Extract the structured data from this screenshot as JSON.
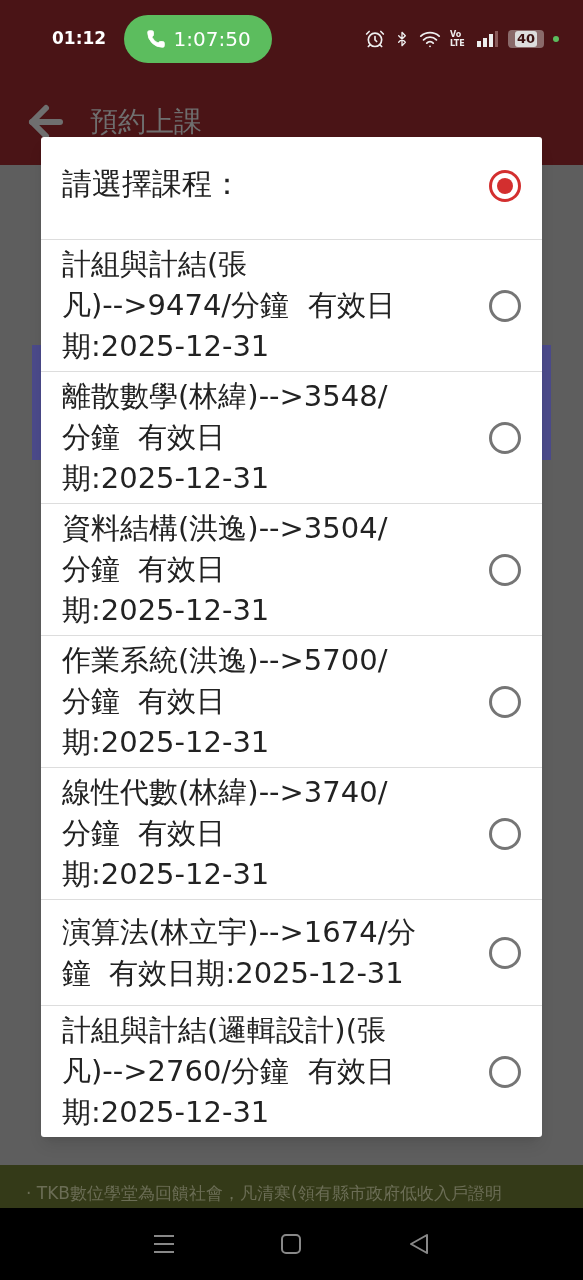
{
  "status_bar": {
    "time": "01:12",
    "call_timer": "1:07:50",
    "network": "Vo LTE",
    "battery": "40"
  },
  "header": {
    "title": "預約上課"
  },
  "footer_note": "· TKB數位學堂為回饋社會，凡清寒(領有縣市政府低收入戶證明",
  "dialog": {
    "prompt": {
      "text": "請選擇課程：",
      "selected": true
    },
    "options": [
      {
        "lines": [
          "計組與計結(張",
          "凡)-->9474/分鐘  有效日",
          "期:2025-12-31"
        ],
        "selected": false
      },
      {
        "lines": [
          "離散數學(林緯)-->3548/",
          "分鐘  有效日",
          "期:2025-12-31"
        ],
        "selected": false
      },
      {
        "lines": [
          "資料結構(洪逸)-->3504/",
          "分鐘  有效日",
          "期:2025-12-31"
        ],
        "selected": false
      },
      {
        "lines": [
          "作業系統(洪逸)-->5700/",
          "分鐘  有效日",
          "期:2025-12-31"
        ],
        "selected": false
      },
      {
        "lines": [
          "線性代數(林緯)-->3740/",
          "分鐘  有效日",
          "期:2025-12-31"
        ],
        "selected": false
      },
      {
        "lines": [
          "演算法(林立宇)-->1674/分",
          "鐘  有效日期:2025-12-31"
        ],
        "selected": false
      },
      {
        "lines": [
          "計組與計結(邏輯設計)(張",
          "凡)-->2760/分鐘  有效日",
          "期:2025-12-31"
        ],
        "selected": false
      }
    ]
  }
}
